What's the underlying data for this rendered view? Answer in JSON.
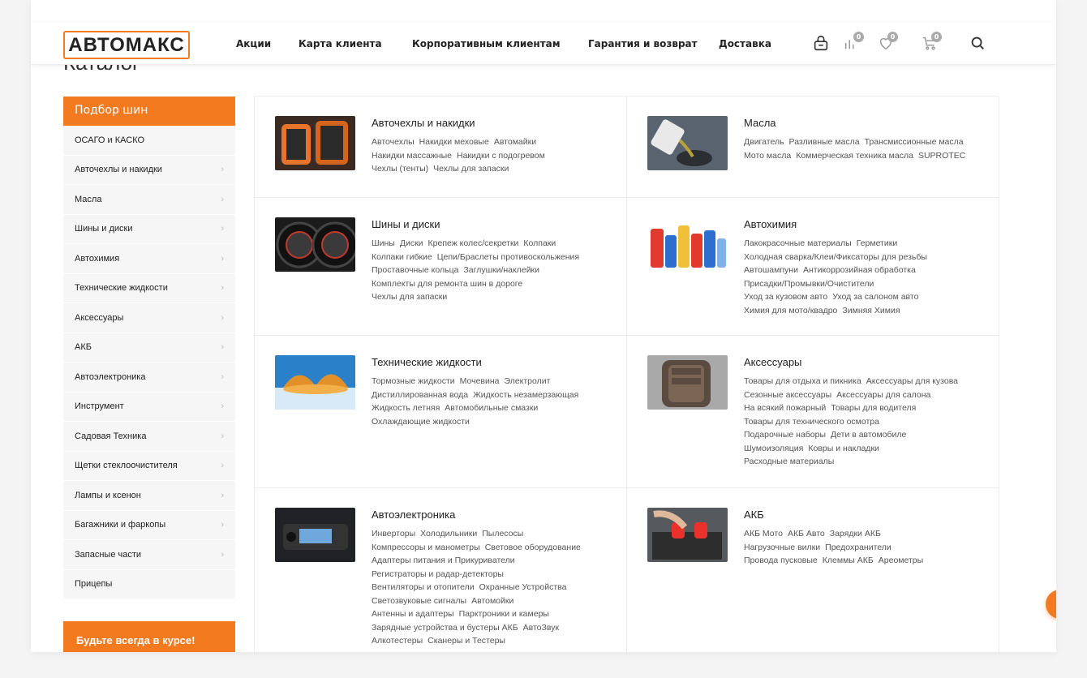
{
  "header": {
    "logo": "АВТОМАКС",
    "nav": [
      "Акции",
      "Карта клиента",
      "Корпоративным клиентам",
      "Гарантия и возврат",
      "Доставка"
    ],
    "badges": {
      "compare": "0",
      "favorites": "0",
      "cart": "0"
    }
  },
  "catalog_title": "Каталог",
  "sidebar": {
    "header": "Подбор шин",
    "items": [
      {
        "label": "ОСАГО и КАСКО",
        "chevron": false
      },
      {
        "label": "Авточехлы и накидки",
        "chevron": true
      },
      {
        "label": "Масла",
        "chevron": true
      },
      {
        "label": "Шины и диски",
        "chevron": true
      },
      {
        "label": "Автохимия",
        "chevron": true
      },
      {
        "label": "Технические жидкости",
        "chevron": true
      },
      {
        "label": "Аксессуары",
        "chevron": true
      },
      {
        "label": "АКБ",
        "chevron": true
      },
      {
        "label": "Автоэлектроника",
        "chevron": true
      },
      {
        "label": "Инструмент",
        "chevron": true
      },
      {
        "label": "Садовая Техника",
        "chevron": true
      },
      {
        "label": "Щетки стеклоочистителя",
        "chevron": true
      },
      {
        "label": "Лампы и ксенон",
        "chevron": true
      },
      {
        "label": "Багажники и фаркопы",
        "chevron": true
      },
      {
        "label": "Запасные части",
        "chevron": true
      },
      {
        "label": "Прицепы",
        "chevron": false
      }
    ],
    "promo": "Будьте всегда в курсе!"
  },
  "categories": [
    {
      "title": "Авточехлы и накидки",
      "rows": [
        [
          "Авточехлы",
          "Накидки меховые",
          "Автомайки"
        ],
        [
          "Накидки массажные",
          "Накидки с подогревом"
        ],
        [
          "Чехлы (тенты)",
          "Чехлы для запаски"
        ]
      ]
    },
    {
      "title": "Масла",
      "rows": [
        [
          "Двигатель",
          "Разливные масла",
          "Трансмиссионные масла"
        ],
        [
          "Мото масла",
          "Коммерческая техника масла",
          "SUPROTEC"
        ]
      ]
    },
    {
      "title": "Шины и диски",
      "rows": [
        [
          "Шины",
          "Диски",
          "Крепеж колес/секретки",
          "Колпаки"
        ],
        [
          "Колпаки гибкие",
          "Цепи/Браслеты противоскольжения"
        ],
        [
          "Проставочные кольца",
          "Заглушки/наклейки"
        ],
        [
          "Комплекты для ремонта шин в дороге"
        ],
        [
          "Чехлы для запаски"
        ]
      ]
    },
    {
      "title": "Автохимия",
      "rows": [
        [
          "Лакокрасочные материалы",
          "Герметики"
        ],
        [
          "Холодная сварка/Клеи/Фиксаторы для резьбы"
        ],
        [
          "Автошампуни",
          "Антикоррозийная обработка"
        ],
        [
          "Присадки/Промывки/Очистители"
        ],
        [
          "Уход за кузовом авто",
          "Уход за салоном авто"
        ],
        [
          "Химия для мото/квадро",
          "Зимняя Химия"
        ]
      ]
    },
    {
      "title": "Технические жидкости",
      "rows": [
        [
          "Тормозные жидкости",
          "Мочевина",
          "Электролит"
        ],
        [
          "Дистиллированная вода",
          "Жидкость незамерзающая"
        ],
        [
          "Жидкость летняя",
          "Автомобильные смазки"
        ],
        [
          "Охлаждающие жидкости"
        ]
      ]
    },
    {
      "title": "Аксессуары",
      "rows": [
        [
          "Товары для отдыха и пикника",
          "Аксессуары для кузова"
        ],
        [
          "Сезонные аксессуары",
          "Аксессуары для салона"
        ],
        [
          "На всякий пожарный",
          "Товары для водителя"
        ],
        [
          "Товары для технического осмотра"
        ],
        [
          "Подарочные наборы",
          "Дети в автомобиле"
        ],
        [
          "Шумоизоляция",
          "Ковры и накладки"
        ],
        [
          "Расходные материалы"
        ]
      ]
    },
    {
      "title": "Автоэлектроника",
      "rows": [
        [
          "Инверторы",
          "Холодильники",
          "Пылесосы"
        ],
        [
          "Компрессоры и манометры",
          "Световое оборудование"
        ],
        [
          "Адаптеры питания и Прикуриватели"
        ],
        [
          "Регистраторы и радар-детекторы"
        ],
        [
          "Вентиляторы и отопители",
          "Охранные Устройства"
        ],
        [
          "Светозвуковые сигналы",
          "Автомойки"
        ],
        [
          "Антенны и адаптеры",
          "Парктроники и камеры"
        ],
        [
          "Зарядные устройства и бустеры АКБ",
          "АвтоЗвук"
        ],
        [
          "Алкотестеры",
          "Сканеры и Тестеры"
        ]
      ]
    },
    {
      "title": "АКБ",
      "rows": [
        [
          "АКБ Мото",
          "АКБ Авто",
          "Зарядки АКБ"
        ],
        [
          "Нагрузочные вилки",
          "Предохранители"
        ],
        [
          "Провода пусковые",
          "Клеммы АКБ",
          "Ареометры"
        ]
      ]
    }
  ]
}
